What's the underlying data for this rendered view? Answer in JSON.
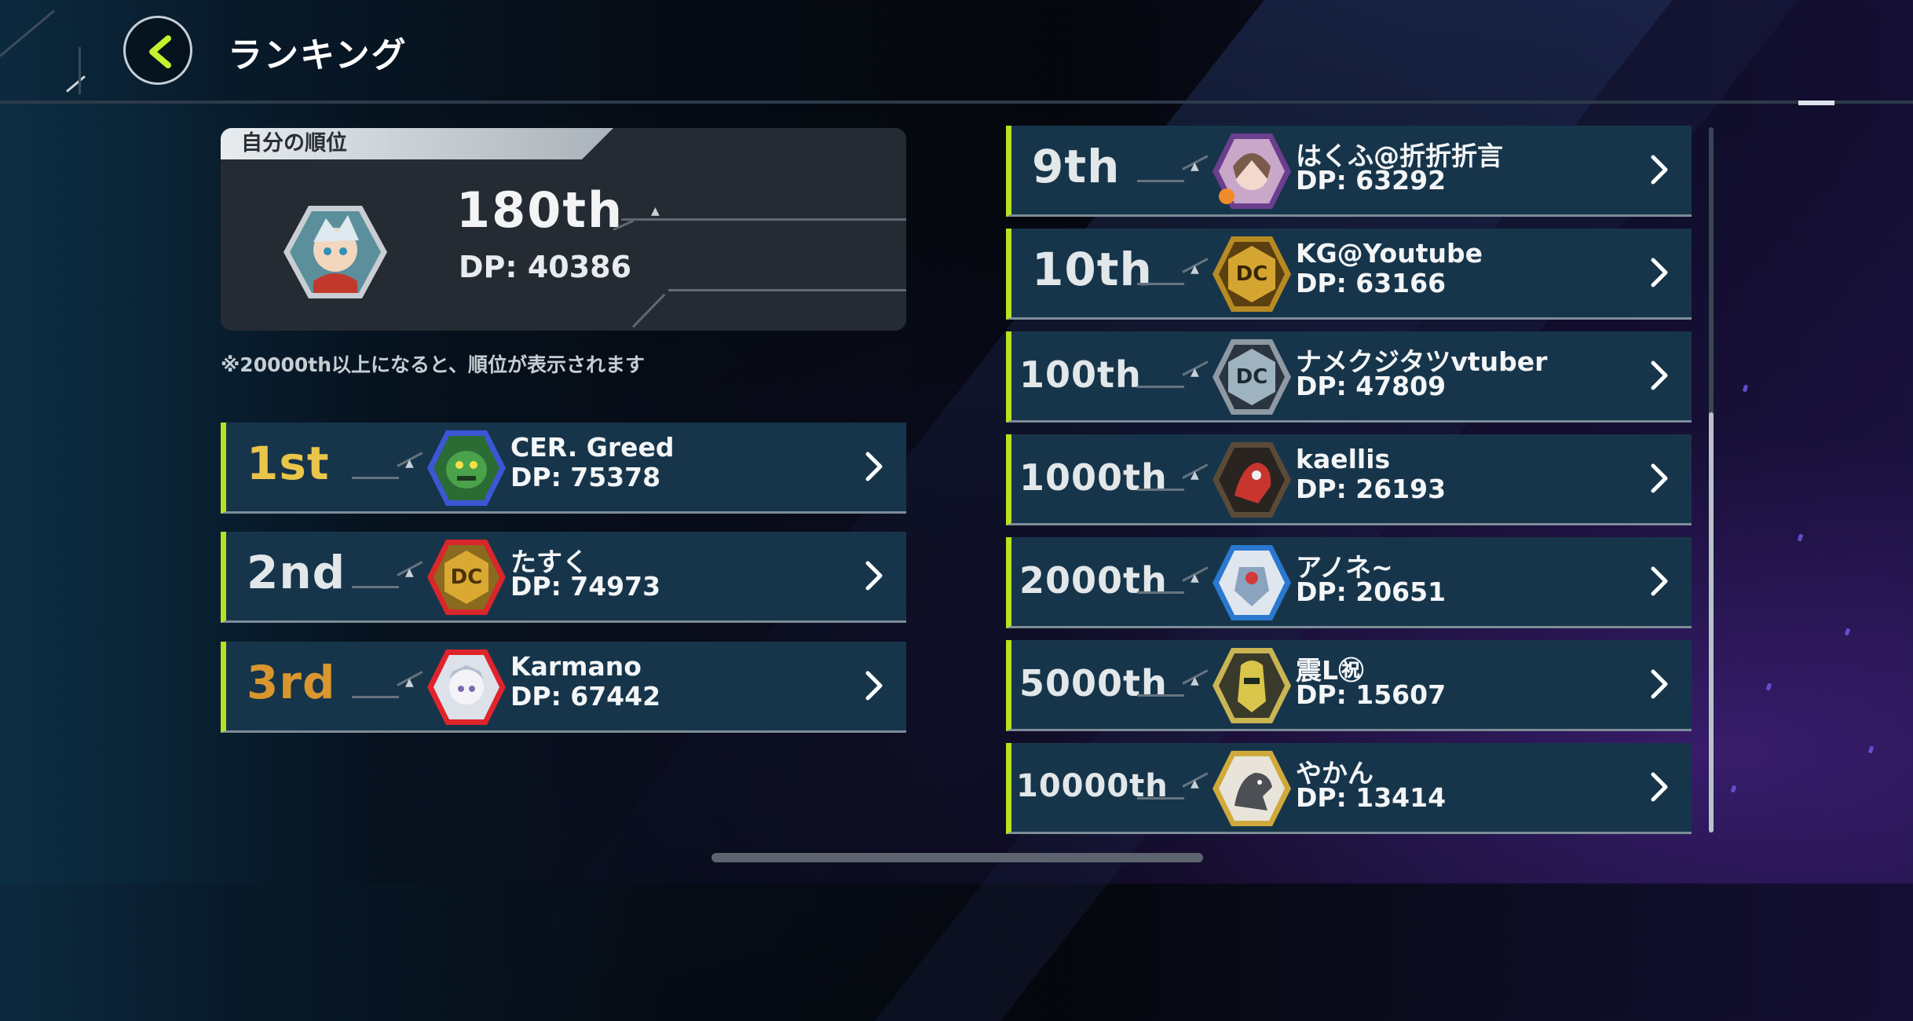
{
  "header": {
    "title": "ランキング",
    "back_icon": "chevron-left-icon",
    "accent": "#c6f12e"
  },
  "my_rank": {
    "tab_label": "自分の順位",
    "rank": "180th",
    "dp": "DP: 40386",
    "note": "※20000th以上になると、順位が表示されます"
  },
  "left_rows": [
    {
      "rank": "1st",
      "name": "CER. Greed",
      "dp": "DP: 75378"
    },
    {
      "rank": "2nd",
      "name": "たすく",
      "dp": "DP: 74973"
    },
    {
      "rank": "3rd",
      "name": "Karmano",
      "dp": "DP: 67442"
    }
  ],
  "right_rows": [
    {
      "rank": "9th",
      "name": "はくふ@折折折言",
      "dp": "DP: 63292"
    },
    {
      "rank": "10th",
      "name": "KG@Youtube",
      "dp": "DP: 63166"
    },
    {
      "rank": "100th",
      "name": "ナメクジタツvtuber",
      "dp": "DP: 47809"
    },
    {
      "rank": "1000th",
      "name": "kaellis",
      "dp": "DP: 26193"
    },
    {
      "rank": "2000th",
      "name": "アノネ~",
      "dp": "DP: 20651"
    },
    {
      "rank": "5000th",
      "name": "震L㊗",
      "dp": "DP: 15607"
    },
    {
      "rank": "10000th",
      "name": "やかん",
      "dp": "DP: 13414"
    }
  ],
  "colors": {
    "row_bg": "#17354a",
    "row_accent": "#b6e221",
    "gold": "#e9c54a",
    "bronze": "#d9962f"
  }
}
